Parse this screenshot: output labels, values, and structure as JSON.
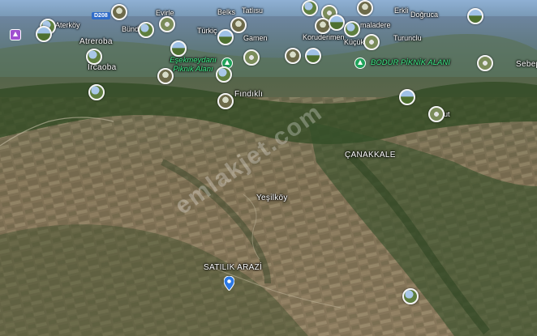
{
  "places": [
    {
      "id": "aterkoy",
      "text": "Aterköy"
    },
    {
      "id": "d208",
      "text": "D208"
    },
    {
      "id": "bundi",
      "text": "Bündi"
    },
    {
      "id": "evirle",
      "text": "Evirle"
    },
    {
      "id": "belks",
      "text": "Belks"
    },
    {
      "id": "tatlisu",
      "text": "Tatlısu"
    },
    {
      "id": "erkli",
      "text": "Erkli"
    },
    {
      "id": "dogruca",
      "text": "Doğruca"
    },
    {
      "id": "atreroba",
      "text": "Atreroba"
    },
    {
      "id": "turkic",
      "text": "Türkiç"
    },
    {
      "id": "gamen",
      "text": "Gamen"
    },
    {
      "id": "koruderimen",
      "text": "Koruderimen"
    },
    {
      "id": "maladere",
      "text": "maladere"
    },
    {
      "id": "turunclu",
      "text": "Turunclu"
    },
    {
      "id": "kucukli",
      "text": "Küçüklü"
    },
    {
      "id": "ircaoba",
      "text": "İrcaoba"
    },
    {
      "id": "fndikli",
      "text": "Fındıklı"
    },
    {
      "id": "sebep",
      "text": "Sebep"
    },
    {
      "id": "ut",
      "text": "ut"
    },
    {
      "id": "canakkale",
      "text": "ÇANAKKALE"
    },
    {
      "id": "yesilkoy",
      "text": "Yeşilköy"
    },
    {
      "id": "satilik",
      "text": "SATILIK ARAZİ"
    }
  ],
  "pois": {
    "eskimeydani": "Eşekmeydanı Piknik Alanı",
    "bodur": "BODUR PİKNİK ALANI"
  },
  "watermark": {
    "main": "emlakjet.com"
  },
  "colors": {
    "terrain": "#6d6148",
    "forest": "#2f4a22",
    "sky": "#7fa2c8",
    "poi_green": "#3ff08a",
    "marker_blue": "#2b78e4"
  }
}
